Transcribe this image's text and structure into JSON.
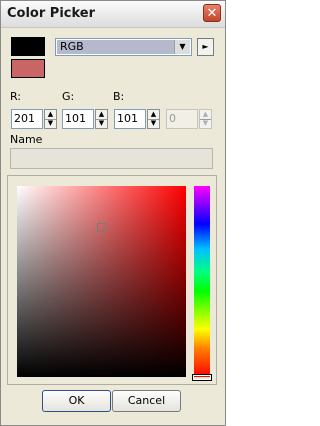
{
  "window": {
    "title": "Color Picker",
    "close_glyph": "✕"
  },
  "swatches": {
    "old_color": "#000000",
    "new_color": "#c96565"
  },
  "mode_select": {
    "value": "RGB",
    "arrow_glyph": "▼"
  },
  "more_button": {
    "glyph": "►"
  },
  "fields": {
    "r": {
      "label": "R:",
      "value": "201"
    },
    "g": {
      "label": "G:",
      "value": "101"
    },
    "b": {
      "label": "B:",
      "value": "101"
    },
    "a": {
      "value": "0"
    }
  },
  "name": {
    "label": "Name",
    "value": ""
  },
  "spinner": {
    "up_glyph": "▲",
    "down_glyph": "▼"
  },
  "buttons": {
    "ok": "OK",
    "cancel": "Cancel"
  },
  "colors": {
    "hue_base": "#ff0000",
    "accent_border": "#2f4e8c"
  }
}
